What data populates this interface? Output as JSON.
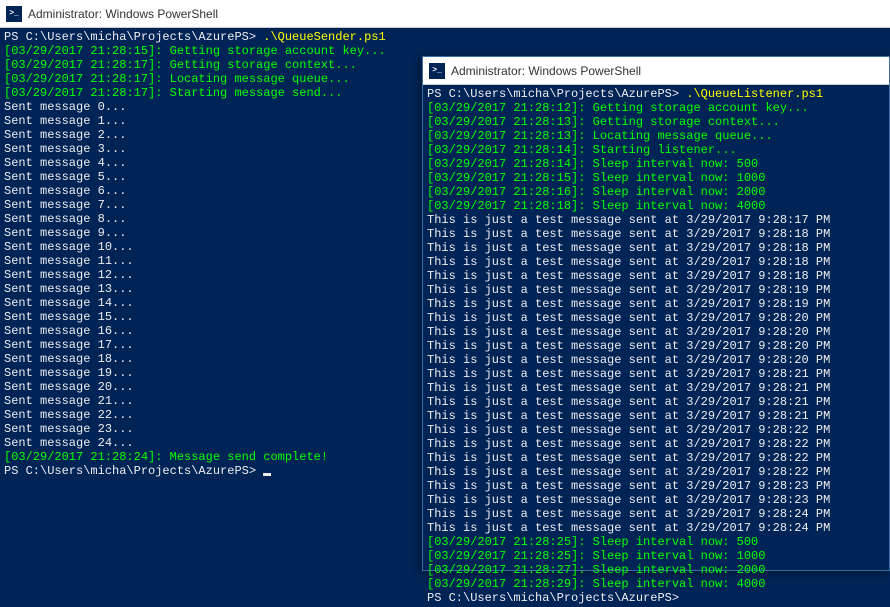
{
  "left": {
    "title": "Administrator: Windows PowerShell",
    "prompt_path": "PS C:\\Users\\micha\\Projects\\AzurePS> ",
    "command": ".\\QueueSender.ps1",
    "logs": [
      "[03/29/2017 21:28:15]: Getting storage account key...",
      "[03/29/2017 21:28:17]: Getting storage context...",
      "[03/29/2017 21:28:17]: Locating message queue...",
      "[03/29/2017 21:28:17]: Starting message send..."
    ],
    "sent": [
      "Sent message 0...",
      "Sent message 1...",
      "Sent message 2...",
      "Sent message 3...",
      "Sent message 4...",
      "Sent message 5...",
      "Sent message 6...",
      "Sent message 7...",
      "Sent message 8...",
      "Sent message 9...",
      "Sent message 10...",
      "Sent message 11...",
      "Sent message 12...",
      "Sent message 13...",
      "Sent message 14...",
      "Sent message 15...",
      "Sent message 16...",
      "Sent message 17...",
      "Sent message 18...",
      "Sent message 19...",
      "Sent message 20...",
      "Sent message 21...",
      "Sent message 22...",
      "Sent message 23...",
      "Sent message 24..."
    ],
    "complete": "[03/29/2017 21:28:24]: Message send complete!",
    "final_prompt": "PS C:\\Users\\micha\\Projects\\AzurePS> "
  },
  "right": {
    "title": "Administrator: Windows PowerShell",
    "prompt_path": "PS C:\\Users\\micha\\Projects\\AzurePS> ",
    "command": ".\\QueueListener.ps1",
    "logs1": [
      "[03/29/2017 21:28:12]: Getting storage account key...",
      "[03/29/2017 21:28:13]: Getting storage context...",
      "[03/29/2017 21:28:13]: Locating message queue...",
      "[03/29/2017 21:28:14]: Starting listener...",
      "[03/29/2017 21:28:14]: Sleep interval now: 500",
      "[03/29/2017 21:28:15]: Sleep interval now: 1000",
      "[03/29/2017 21:28:16]: Sleep interval now: 2000",
      "[03/29/2017 21:28:18]: Sleep interval now: 4000"
    ],
    "messages": [
      "This is just a test message sent at 3/29/2017 9:28:17 PM",
      "This is just a test message sent at 3/29/2017 9:28:18 PM",
      "This is just a test message sent at 3/29/2017 9:28:18 PM",
      "This is just a test message sent at 3/29/2017 9:28:18 PM",
      "This is just a test message sent at 3/29/2017 9:28:18 PM",
      "This is just a test message sent at 3/29/2017 9:28:19 PM",
      "This is just a test message sent at 3/29/2017 9:28:19 PM",
      "This is just a test message sent at 3/29/2017 9:28:20 PM",
      "This is just a test message sent at 3/29/2017 9:28:20 PM",
      "This is just a test message sent at 3/29/2017 9:28:20 PM",
      "This is just a test message sent at 3/29/2017 9:28:20 PM",
      "This is just a test message sent at 3/29/2017 9:28:21 PM",
      "This is just a test message sent at 3/29/2017 9:28:21 PM",
      "This is just a test message sent at 3/29/2017 9:28:21 PM",
      "This is just a test message sent at 3/29/2017 9:28:21 PM",
      "This is just a test message sent at 3/29/2017 9:28:22 PM",
      "This is just a test message sent at 3/29/2017 9:28:22 PM",
      "This is just a test message sent at 3/29/2017 9:28:22 PM",
      "This is just a test message sent at 3/29/2017 9:28:22 PM",
      "This is just a test message sent at 3/29/2017 9:28:23 PM",
      "This is just a test message sent at 3/29/2017 9:28:23 PM",
      "This is just a test message sent at 3/29/2017 9:28:24 PM",
      "This is just a test message sent at 3/29/2017 9:28:24 PM"
    ],
    "logs2": [
      "[03/29/2017 21:28:25]: Sleep interval now: 500",
      "[03/29/2017 21:28:25]: Sleep interval now: 1000",
      "[03/29/2017 21:28:27]: Sleep interval now: 2000",
      "[03/29/2017 21:28:29]: Sleep interval now: 4000"
    ],
    "final_prompt": "PS C:\\Users\\micha\\Projects\\AzurePS>"
  }
}
